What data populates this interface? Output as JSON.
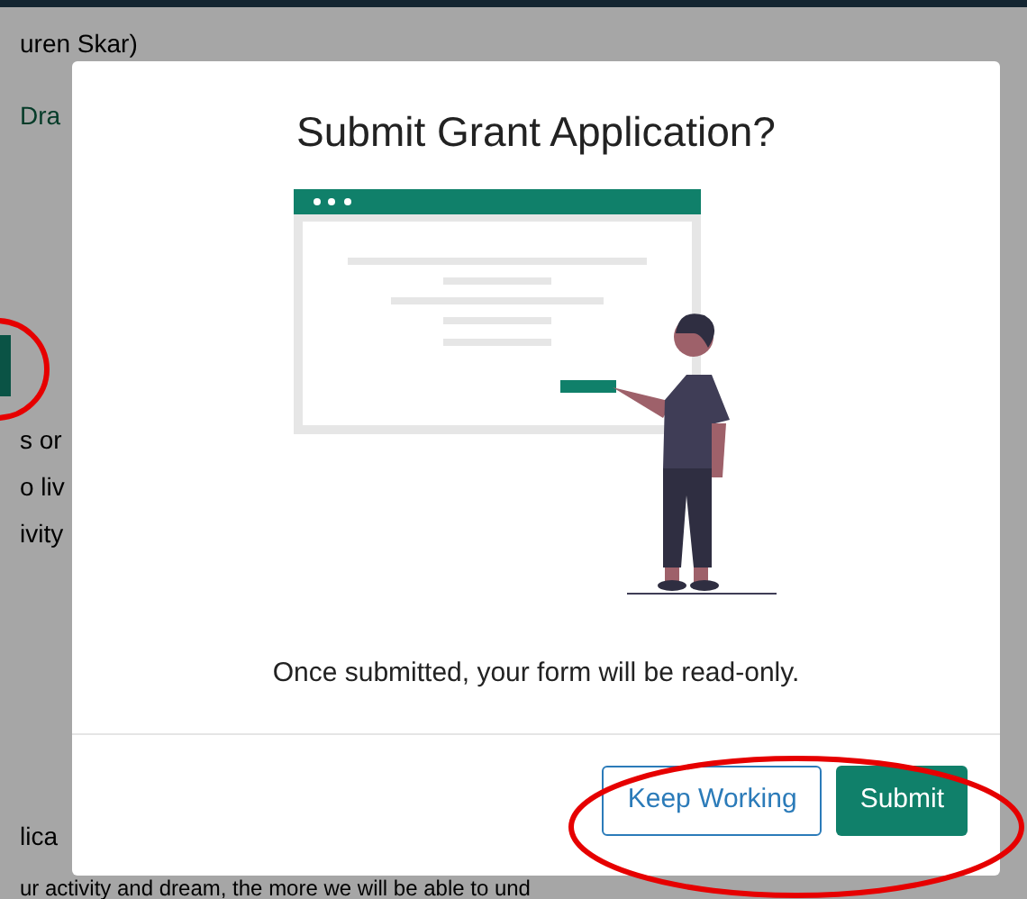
{
  "background_page": {
    "texts": [
      {
        "kind": "plain",
        "text": "uren Skar)"
      },
      {
        "kind": "link",
        "text": "Dra"
      },
      {
        "kind": "plain",
        "text": "s or"
      },
      {
        "kind": "plain",
        "text": "o liv"
      },
      {
        "kind": "plain",
        "text": "ivity"
      },
      {
        "kind": "plain",
        "text": "lica"
      },
      {
        "kind": "plain",
        "text": "ur activity and dream, the more we will be able to und"
      }
    ]
  },
  "dialog": {
    "title": "Submit Grant Application?",
    "message": "Once submitted, your form will be read-only.",
    "buttons": [
      {
        "label": "Keep Working",
        "kind": "secondary"
      },
      {
        "label": "Submit",
        "kind": "primary"
      }
    ]
  }
}
